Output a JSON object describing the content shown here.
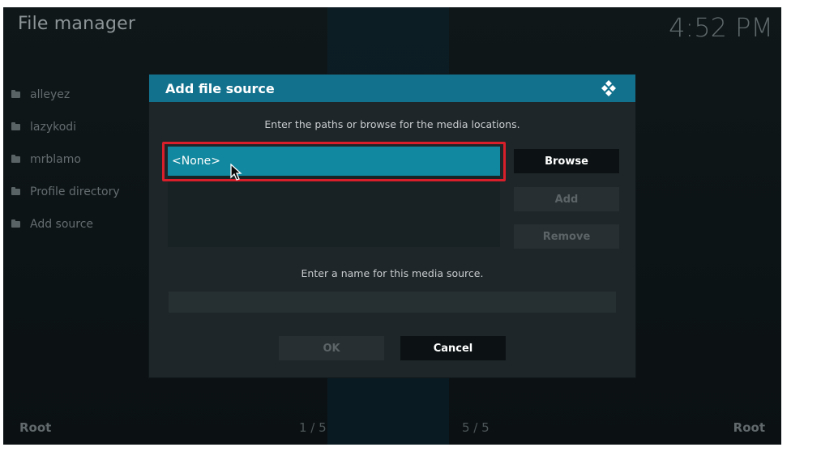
{
  "app": {
    "title": "File manager",
    "clock": "4:52 PM"
  },
  "sidebar": {
    "items": [
      {
        "label": "alleyez",
        "icon": "folder-icon"
      },
      {
        "label": "lazykodi",
        "icon": "folder-icon"
      },
      {
        "label": "mrblamo",
        "icon": "folder-icon"
      },
      {
        "label": "Profile directory",
        "icon": "folder-icon"
      },
      {
        "label": "Add source",
        "icon": "folder-icon"
      }
    ]
  },
  "footer": {
    "left_label": "Root",
    "left_page": "1 / 5",
    "right_page": "5 / 5",
    "right_label": "Root"
  },
  "dialog": {
    "title": "Add file source",
    "paths_hint": "Enter the paths or browse for the media locations.",
    "paths": [
      "<None>"
    ],
    "buttons": {
      "browse": "Browse",
      "add": "Add",
      "remove": "Remove",
      "ok": "OK",
      "cancel": "Cancel"
    },
    "name_hint": "Enter a name for this media source.",
    "name_value": "",
    "accent_color": "#12718d",
    "highlight_color": "#d91f2a"
  }
}
